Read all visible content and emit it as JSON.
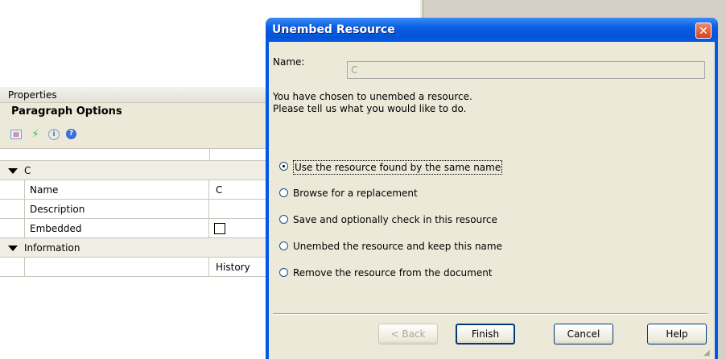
{
  "properties_panel": {
    "header": "Properties",
    "subheader": "Paragraph Options",
    "toolbar_icons": [
      "document-icon",
      "lightning-icon",
      "info-icon",
      "help-icon"
    ],
    "category_c": "C",
    "rows": [
      {
        "label": "Name",
        "value": "C"
      },
      {
        "label": "Description",
        "value": ""
      },
      {
        "label": "Embedded",
        "value": ""
      }
    ],
    "category_info": "Information",
    "history_value": "History"
  },
  "dialog": {
    "title": "Unembed Resource",
    "name_label": "Name:",
    "name_value": "C",
    "message_line1": "You have chosen to unembed a resource.",
    "message_line2": "Please tell us what you would like to do.",
    "options": [
      {
        "label": "Use the resource found by the same name",
        "selected": true
      },
      {
        "label": "Browse for a replacement",
        "selected": false
      },
      {
        "label": "Save and optionally check in this resource",
        "selected": false
      },
      {
        "label": "Unembed the resource and keep this name",
        "selected": false
      },
      {
        "label": "Remove the resource from the document",
        "selected": false
      }
    ],
    "buttons": {
      "back": "< Back",
      "finish": "Finish",
      "cancel": "Cancel",
      "help": "Help"
    },
    "close_glyph": "✕"
  },
  "colors": {
    "titlebar": "#0a5fe2",
    "dialog_bg": "#ece9d8",
    "close_button": "#d8401a"
  }
}
